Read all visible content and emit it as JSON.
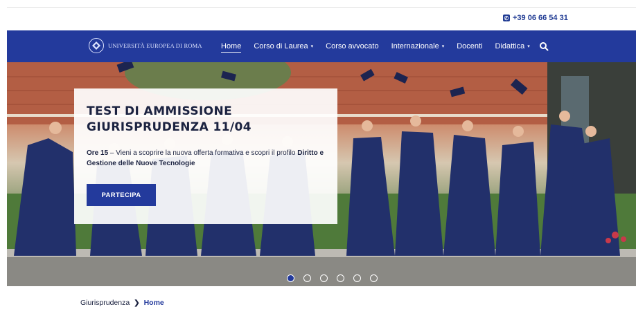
{
  "header": {
    "phone": "+39 06 66 54 31",
    "phone_icon": "phone-icon"
  },
  "nav": {
    "brand": "UNIVERSITÀ EUROPEA DI ROMA",
    "items": [
      {
        "label": "Home",
        "active": true,
        "dropdown": false
      },
      {
        "label": "Corso di Laurea",
        "active": false,
        "dropdown": true
      },
      {
        "label": "Corso avvocato",
        "active": false,
        "dropdown": false
      },
      {
        "label": "Internazionale",
        "active": false,
        "dropdown": true
      },
      {
        "label": "Docenti",
        "active": false,
        "dropdown": false
      },
      {
        "label": "Didattica",
        "active": false,
        "dropdown": true
      }
    ],
    "search_icon": "search-icon",
    "caret": "▾"
  },
  "hero": {
    "title": "TEST DI AMMISSIONE GIURISPRUDENZA 11/04",
    "text_bold": "Ore 15",
    "text": " – Vieni a scoprire la nuova offerta formativa e scopri il profilo ",
    "text_bold2": "Diritto e Gestione delle Nuove Tecnologie",
    "cta_label": "PARTECIPA",
    "slides": 6,
    "active_slide": 0
  },
  "breadcrumb": {
    "parent": "Giurisprudenza",
    "separator": "❯",
    "current": "Home"
  },
  "colors": {
    "brand": "#233a9c",
    "text_dark": "#1b2240"
  }
}
